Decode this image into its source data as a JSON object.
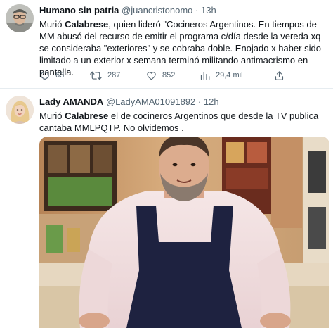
{
  "tweets": [
    {
      "display_name": "Humano sin patria",
      "handle": "@juancristonomo",
      "separator": "·",
      "time": "13h",
      "text_segments": [
        {
          "text": "Murió ",
          "bold": false
        },
        {
          "text": "Calabrese",
          "bold": true
        },
        {
          "text": ", quien lideró \"Cocineros Argentinos. En tiempos de MM abusó del recurso de emitir el programa c/día desde la vereda xq se consideraba \"exteriores\" y se cobraba doble. Enojado x haber sido limitado a un exterior x semana terminó militando antimacrismo en pantalla.",
          "bold": false
        }
      ],
      "stats": {
        "replies": "63",
        "retweets": "287",
        "likes": "852",
        "views": "29,4 mil"
      }
    },
    {
      "display_name": "Lady AMANDA",
      "handle": "@LadyAMA01091892",
      "separator": "·",
      "time": "12h",
      "text_segments": [
        {
          "text": "Murió ",
          "bold": false
        },
        {
          "text": "Calabrese",
          "bold": true
        },
        {
          "text": " el de cocineros Argentinos que desde la TV publica cantaba MMLPQTP.  No olvidemos .",
          "bold": false
        }
      ]
    }
  ],
  "icons": {
    "reply": "reply-icon",
    "retweet": "retweet-icon",
    "like": "heart-icon",
    "views": "views-icon",
    "share": "share-icon"
  },
  "colors": {
    "text_primary": "#0f1419",
    "text_secondary": "#536471",
    "divider": "#e6ecf0"
  }
}
